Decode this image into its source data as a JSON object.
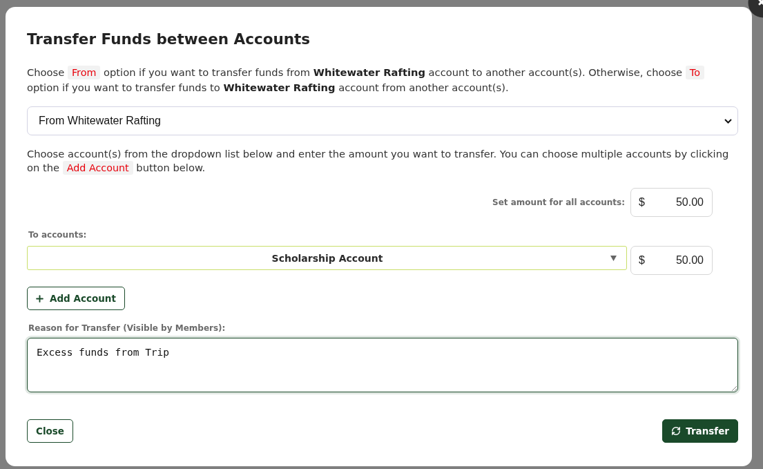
{
  "dialog": {
    "title": "Transfer Funds between Accounts"
  },
  "intro": [
    {
      "kind": "text",
      "text": "Choose "
    },
    {
      "kind": "code",
      "text": "From"
    },
    {
      "kind": "text",
      "text": " option if you want to transfer funds from **Whitewater Rafting** account to another account(s). Otherwise, choose "
    },
    {
      "kind": "code",
      "text": "To"
    },
    {
      "kind": "text",
      "text": " option if you want to transfer funds to **Whitewater Rafting** account from another account(s)."
    }
  ],
  "direction_select": {
    "value": "From Whitewater Rafting"
  },
  "instructions": [
    {
      "kind": "text",
      "text": "Choose account(s) from the dropdown list below and enter the amount you want to transfer. You can choose multiple accounts by clicking on the "
    },
    {
      "kind": "code",
      "text": "Add Account"
    },
    {
      "kind": "text",
      "text": " button below."
    }
  ],
  "set_all": {
    "label": "Set amount for all accounts:",
    "currency": "$",
    "value": "50.00"
  },
  "to_accounts": {
    "label": "To accounts:",
    "rows": [
      {
        "account": "Scholarship Account",
        "currency": "$",
        "amount": "50.00"
      }
    ]
  },
  "add_button": {
    "label": "Add Account"
  },
  "reason": {
    "label": "Reason for Transfer (Visible by Members):",
    "value": "Excess funds from Trip",
    "focused": true
  },
  "buttons": [
    {
      "kind": "secondary",
      "label": "Close"
    },
    {
      "kind": "primary",
      "label": "Transfer"
    }
  ]
}
